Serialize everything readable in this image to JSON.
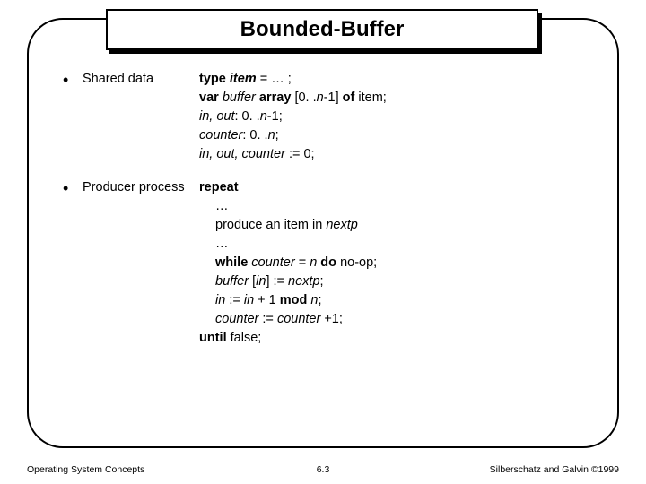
{
  "title": "Bounded-Buffer",
  "bullets": {
    "shared": {
      "label": "Shared data",
      "lines": {
        "l1_a": "type ",
        "l1_b": "item",
        "l1_c": " = … ;",
        "l2_a": "var ",
        "l2_b": "buffer",
        "l2_c": " array ",
        "l2_d": "[0. .",
        "l2_e": "n",
        "l2_f": "-1] ",
        "l2_g": "of ",
        "l2_h": "item;",
        "l3_a": "in, out",
        "l3_b": ": 0. .",
        "l3_c": "n",
        "l3_d": "-1;",
        "l4_a": "counter",
        "l4_b": ": 0. .",
        "l4_c": "n",
        "l4_d": ";",
        "l5_a": "in, out, counter",
        "l5_b": " := 0;"
      }
    },
    "producer": {
      "label": "Producer process",
      "lines": {
        "l1": "repeat",
        "l2": "…",
        "l3_a": "produce an item in ",
        "l3_b": "nextp",
        "l4": "…",
        "l5_a": "while ",
        "l5_b": "counter",
        "l5_c": " = ",
        "l5_d": "n",
        "l5_e": " do ",
        "l5_f": "no-op;",
        "l6_a": "buffer",
        "l6_b": " [",
        "l6_c": "in",
        "l6_d": "] := ",
        "l6_e": "nextp",
        "l6_f": ";",
        "l7_a": "in",
        "l7_b": " := ",
        "l7_c": "in",
        "l7_d": " + 1 ",
        "l7_e": "mod ",
        "l7_f": "n",
        "l7_g": ";",
        "l8_a": "counter",
        "l8_b": " := ",
        "l8_c": "counter",
        "l8_d": " +1;",
        "l9": "until ",
        "l9_b": "false;"
      }
    }
  },
  "footer": {
    "left": "Operating System Concepts",
    "center": "6.3",
    "right": "Silberschatz and Galvin ©1999"
  }
}
